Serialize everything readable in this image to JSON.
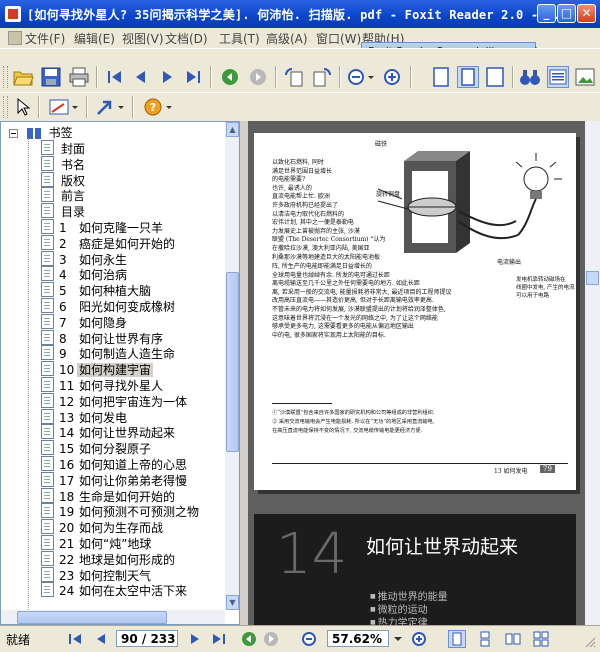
{
  "window": {
    "title": "[如何寻找外星人? 35问揭示科学之美]. 何沛怡. 扫描版. pdf - Foxit Reader 2.0 - ...",
    "minimize": "_",
    "maximize": "□",
    "close": "✕"
  },
  "menu": {
    "items": [
      "文件(F)",
      "编辑(E)",
      "视图(V)",
      "文档(D)",
      "工具(T)",
      "高级(A)",
      "窗口(W)",
      "帮助(H)"
    ],
    "promo": "Foxit Reader Pro,work like a pro!"
  },
  "bookmarks": {
    "root_label": "书签",
    "items": [
      {
        "num": "",
        "label": "封面"
      },
      {
        "num": "",
        "label": "书名"
      },
      {
        "num": "",
        "label": "版权"
      },
      {
        "num": "",
        "label": "前言"
      },
      {
        "num": "",
        "label": "目录"
      },
      {
        "num": "1",
        "label": "如何克隆一只羊"
      },
      {
        "num": "2",
        "label": "癌症是如何开始的"
      },
      {
        "num": "3",
        "label": "如何永生"
      },
      {
        "num": "4",
        "label": "如何治病"
      },
      {
        "num": "5",
        "label": "如何种植大脑"
      },
      {
        "num": "6",
        "label": "阳光如何变成橡树"
      },
      {
        "num": "7",
        "label": "如何隐身"
      },
      {
        "num": "8",
        "label": "如何让世界有序"
      },
      {
        "num": "9",
        "label": "如何制造人造生命"
      },
      {
        "num": "10",
        "label": "如何构建宇宙"
      },
      {
        "num": "11",
        "label": "如何寻找外星人"
      },
      {
        "num": "12",
        "label": "如何把宇宙连为一体"
      },
      {
        "num": "13",
        "label": "如何发电"
      },
      {
        "num": "14",
        "label": "如何让世界动起来"
      },
      {
        "num": "15",
        "label": "如何分裂原子"
      },
      {
        "num": "16",
        "label": "如何知道上帝的心思"
      },
      {
        "num": "17",
        "label": "如何让你弟弟老得慢"
      },
      {
        "num": "18",
        "label": "生命是如何开始的"
      },
      {
        "num": "19",
        "label": "如何预测不可预测之物"
      },
      {
        "num": "20",
        "label": "如何为生存而战"
      },
      {
        "num": "21",
        "label": "如何“炖”地球"
      },
      {
        "num": "22",
        "label": "地球是如何形成的"
      },
      {
        "num": "23",
        "label": "如何控制天气"
      },
      {
        "num": "24",
        "label": "如何在太空中活下来"
      }
    ],
    "selected_index": 14
  },
  "document": {
    "page1": {
      "body_left": [
        "以致化石燃料, 同时",
        "满足世界范围日益增长",
        "的电能需要?",
        "也许, 最诱人的",
        "直流电能帮上忙. 欧洲",
        "许多政府机构已经提出了",
        "以清洁电力取代化石燃料的",
        "宏伟计划, 其中之一便是泰勒电",
        "力发展史上曾被抛弃的主张, 沙漠",
        "联盟 (The Desertec Consortium) “认为",
        "在撒哈拉沙漠, 澳大利亚内陆, 美国亚",
        "利桑那沙漠等地建造巨大的太阳能电池板"
      ],
      "body_full": [
        "阵, 所生产的电能即能满足日益增长的",
        "全球用电量也绰绰有余. 所发的电可通过长距",
        "离电缆输送至几千公里之外任何需要电的地方. 如此长距",
        "离, 若采用一般的交流电, 能量损耗将非常大, 最近项目的工程师提议",
        "改用高压直流电——其造价更高, 但对于长距离输电效率更高.",
        "不管未来的电力将如何发展, 沙漠联盟提出的计划将给润泽整体色,",
        "这意味着世界将沉浸在一个发光的网络之中, 为了让这个网络能",
        "够承受更多电力, 这需要看更多的电能从偏远地区输出",
        "中的电, 很多国家将实现用上太阳能的目标."
      ],
      "labels": [
        "磁铁",
        "旋转铜盘",
        "电流输出",
        "发电机靠转动磁场在",
        "线圈中发电, 产生的电流",
        "可以用于电路"
      ],
      "footnotes": [
        "①“沙漠联盟”包含来自许多国家的研究机构和公司等组成的非营利组织.",
        "② 采用交流电输电会产生电能损耗. 所以在“无功”的地区采用直流输电,",
        "在高压直流电能保持不变的情况下, 交流电缆传输电能更经济方便."
      ],
      "page_footer": "13  如何发电",
      "page_number": "79"
    },
    "page2": {
      "chapter_number": "14",
      "chapter_title": "如何让世界动起来",
      "bullets": [
        "推动世界的能量",
        "微粒的运动",
        "热力学定律"
      ]
    }
  },
  "status": {
    "ready": "就绪",
    "page_display": "90 / 233",
    "zoom": "57.62%"
  },
  "colors": {
    "titlebar": "#0b45c8",
    "chrome": "#ece9d8",
    "doc_background": "#5f5f5f",
    "page2_background": "#1c1c1c"
  }
}
